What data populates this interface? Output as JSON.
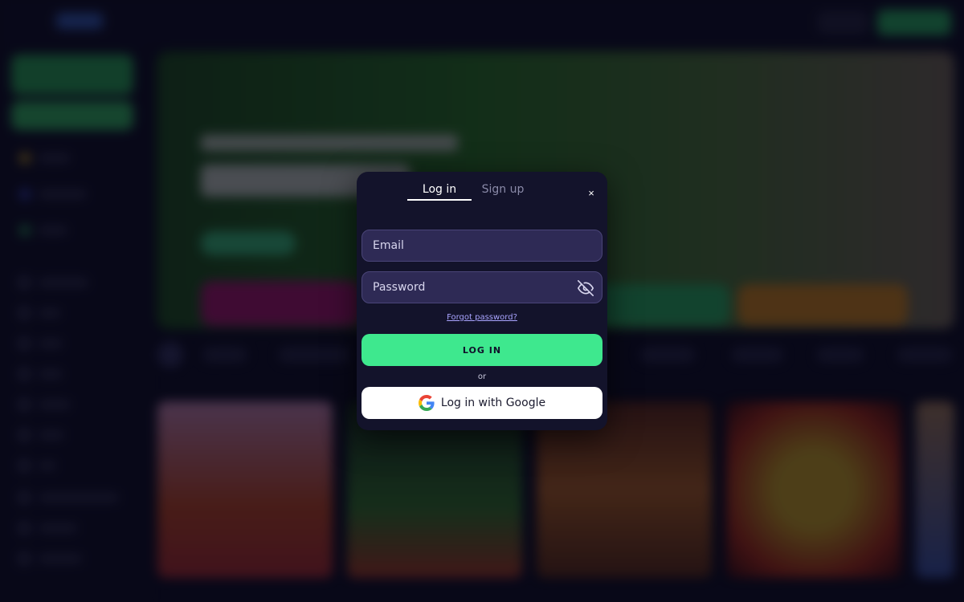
{
  "modal": {
    "tabs": [
      {
        "label": "Log in",
        "active": true
      },
      {
        "label": "Sign up",
        "active": false
      }
    ],
    "close_symbol": "×",
    "email": {
      "placeholder": "Email",
      "value": ""
    },
    "password": {
      "placeholder": "Password",
      "value": "",
      "toggle_icon": "eye-off-icon"
    },
    "forgot_password": "Forgot password?",
    "login_button": "LOG IN",
    "or_text": "or",
    "google_button": "Log in with Google",
    "google_icon": "google-icon"
  },
  "colors": {
    "accent_green": "#3ee88e",
    "modal_bg": "#13132b",
    "field_bg": "#2e2a55",
    "link": "#a9a4ff",
    "page_bg": "#0b0b1f"
  }
}
